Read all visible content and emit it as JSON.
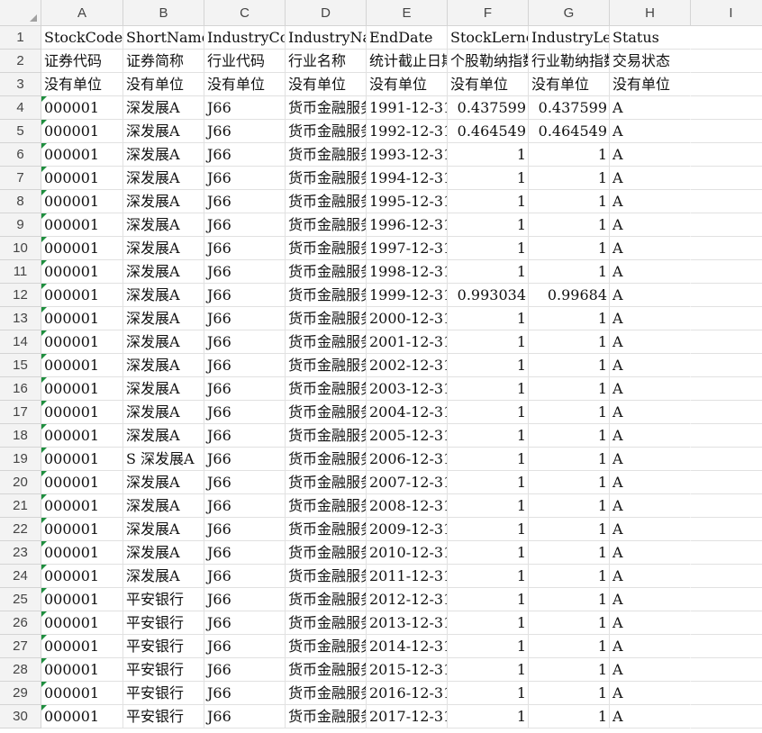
{
  "columns": [
    "A",
    "B",
    "C",
    "D",
    "E",
    "F",
    "G",
    "H",
    "I"
  ],
  "header_rows": [
    [
      "StockCode",
      "ShortName",
      "IndustryCode",
      "IndustryName",
      "EndDate",
      "StockLerner",
      "IndustryLerner",
      "Status"
    ],
    [
      "证券代码",
      "证券简称",
      "行业代码",
      "行业名称",
      "统计截止日期",
      "个股勒纳指数",
      "行业勒纳指数",
      "交易状态"
    ],
    [
      "没有单位",
      "没有单位",
      "没有单位",
      "没有单位",
      "没有单位",
      "没有单位",
      "没有单位",
      "没有单位"
    ]
  ],
  "data_rows": [
    [
      "000001",
      "深发展A",
      "J66",
      "货币金融服务",
      "1991-12-31",
      "0.437599",
      "0.437599",
      "A"
    ],
    [
      "000001",
      "深发展A",
      "J66",
      "货币金融服务",
      "1992-12-31",
      "0.464549",
      "0.464549",
      "A"
    ],
    [
      "000001",
      "深发展A",
      "J66",
      "货币金融服务",
      "1993-12-31",
      "1",
      "1",
      "A"
    ],
    [
      "000001",
      "深发展A",
      "J66",
      "货币金融服务",
      "1994-12-31",
      "1",
      "1",
      "A"
    ],
    [
      "000001",
      "深发展A",
      "J66",
      "货币金融服务",
      "1995-12-31",
      "1",
      "1",
      "A"
    ],
    [
      "000001",
      "深发展A",
      "J66",
      "货币金融服务",
      "1996-12-31",
      "1",
      "1",
      "A"
    ],
    [
      "000001",
      "深发展A",
      "J66",
      "货币金融服务",
      "1997-12-31",
      "1",
      "1",
      "A"
    ],
    [
      "000001",
      "深发展A",
      "J66",
      "货币金融服务",
      "1998-12-31",
      "1",
      "1",
      "A"
    ],
    [
      "000001",
      "深发展A",
      "J66",
      "货币金融服务",
      "1999-12-31",
      "0.993034",
      "0.99684",
      "A"
    ],
    [
      "000001",
      "深发展A",
      "J66",
      "货币金融服务",
      "2000-12-31",
      "1",
      "1",
      "A"
    ],
    [
      "000001",
      "深发展A",
      "J66",
      "货币金融服务",
      "2001-12-31",
      "1",
      "1",
      "A"
    ],
    [
      "000001",
      "深发展A",
      "J66",
      "货币金融服务",
      "2002-12-31",
      "1",
      "1",
      "A"
    ],
    [
      "000001",
      "深发展A",
      "J66",
      "货币金融服务",
      "2003-12-31",
      "1",
      "1",
      "A"
    ],
    [
      "000001",
      "深发展A",
      "J66",
      "货币金融服务",
      "2004-12-31",
      "1",
      "1",
      "A"
    ],
    [
      "000001",
      "深发展A",
      "J66",
      "货币金融服务",
      "2005-12-31",
      "1",
      "1",
      "A"
    ],
    [
      "000001",
      "S 深发展A",
      "J66",
      "货币金融服务",
      "2006-12-31",
      "1",
      "1",
      "A"
    ],
    [
      "000001",
      "深发展A",
      "J66",
      "货币金融服务",
      "2007-12-31",
      "1",
      "1",
      "A"
    ],
    [
      "000001",
      "深发展A",
      "J66",
      "货币金融服务",
      "2008-12-31",
      "1",
      "1",
      "A"
    ],
    [
      "000001",
      "深发展A",
      "J66",
      "货币金融服务",
      "2009-12-31",
      "1",
      "1",
      "A"
    ],
    [
      "000001",
      "深发展A",
      "J66",
      "货币金融服务",
      "2010-12-31",
      "1",
      "1",
      "A"
    ],
    [
      "000001",
      "深发展A",
      "J66",
      "货币金融服务",
      "2011-12-31",
      "1",
      "1",
      "A"
    ],
    [
      "000001",
      "平安银行",
      "J66",
      "货币金融服务",
      "2012-12-31",
      "1",
      "1",
      "A"
    ],
    [
      "000001",
      "平安银行",
      "J66",
      "货币金融服务",
      "2013-12-31",
      "1",
      "1",
      "A"
    ],
    [
      "000001",
      "平安银行",
      "J66",
      "货币金融服务",
      "2014-12-31",
      "1",
      "1",
      "A"
    ],
    [
      "000001",
      "平安银行",
      "J66",
      "货币金融服务",
      "2015-12-31",
      "1",
      "1",
      "A"
    ],
    [
      "000001",
      "平安银行",
      "J66",
      "货币金融服务",
      "2016-12-31",
      "1",
      "1",
      "A"
    ],
    [
      "000001",
      "平安银行",
      "J66",
      "货币金融服务",
      "2017-12-31",
      "1",
      "1",
      "A"
    ]
  ],
  "colors": {
    "header_bg": "#f3f3f3",
    "gridline": "#e1e1e1",
    "text_number_marker": "#1e8e3e"
  }
}
